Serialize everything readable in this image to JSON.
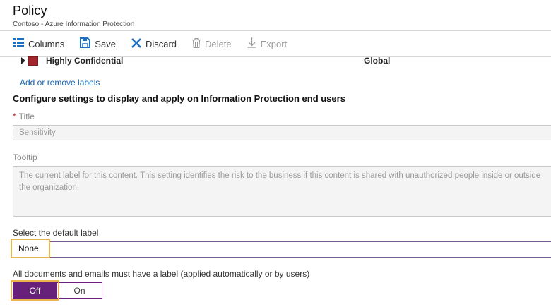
{
  "header": {
    "title": "Policy",
    "subtitle": "Contoso - Azure Information Protection"
  },
  "toolbar": {
    "columns_label": "Columns",
    "save_label": "Save",
    "discard_label": "Discard",
    "delete_label": "Delete",
    "export_label": "Export"
  },
  "labels_table": {
    "rows": [
      {
        "name": "Highly Confidential",
        "scope": "Global",
        "color": "#a4262c"
      }
    ]
  },
  "add_remove_link": "Add or remove labels",
  "section_title": "Configure settings to display and apply on Information Protection end users",
  "title_field": {
    "required_marker": "*",
    "label": "Title",
    "value": "Sensitivity"
  },
  "tooltip_field": {
    "label": "Tooltip",
    "value": "The current label for this content. This setting identifies the risk to the business if this content is shared with unauthorized people inside or outside the organization."
  },
  "default_label": {
    "label": "Select the default label",
    "value": "None"
  },
  "mandatory_labeling": {
    "label": "All documents and emails must have a label (applied automatically or by users)",
    "off_label": "Off",
    "on_label": "On",
    "selected": "Off"
  },
  "colors": {
    "accent": "#68217a",
    "highlight": "#e8b44e",
    "link": "#1464b4",
    "required": "#c4262e"
  }
}
